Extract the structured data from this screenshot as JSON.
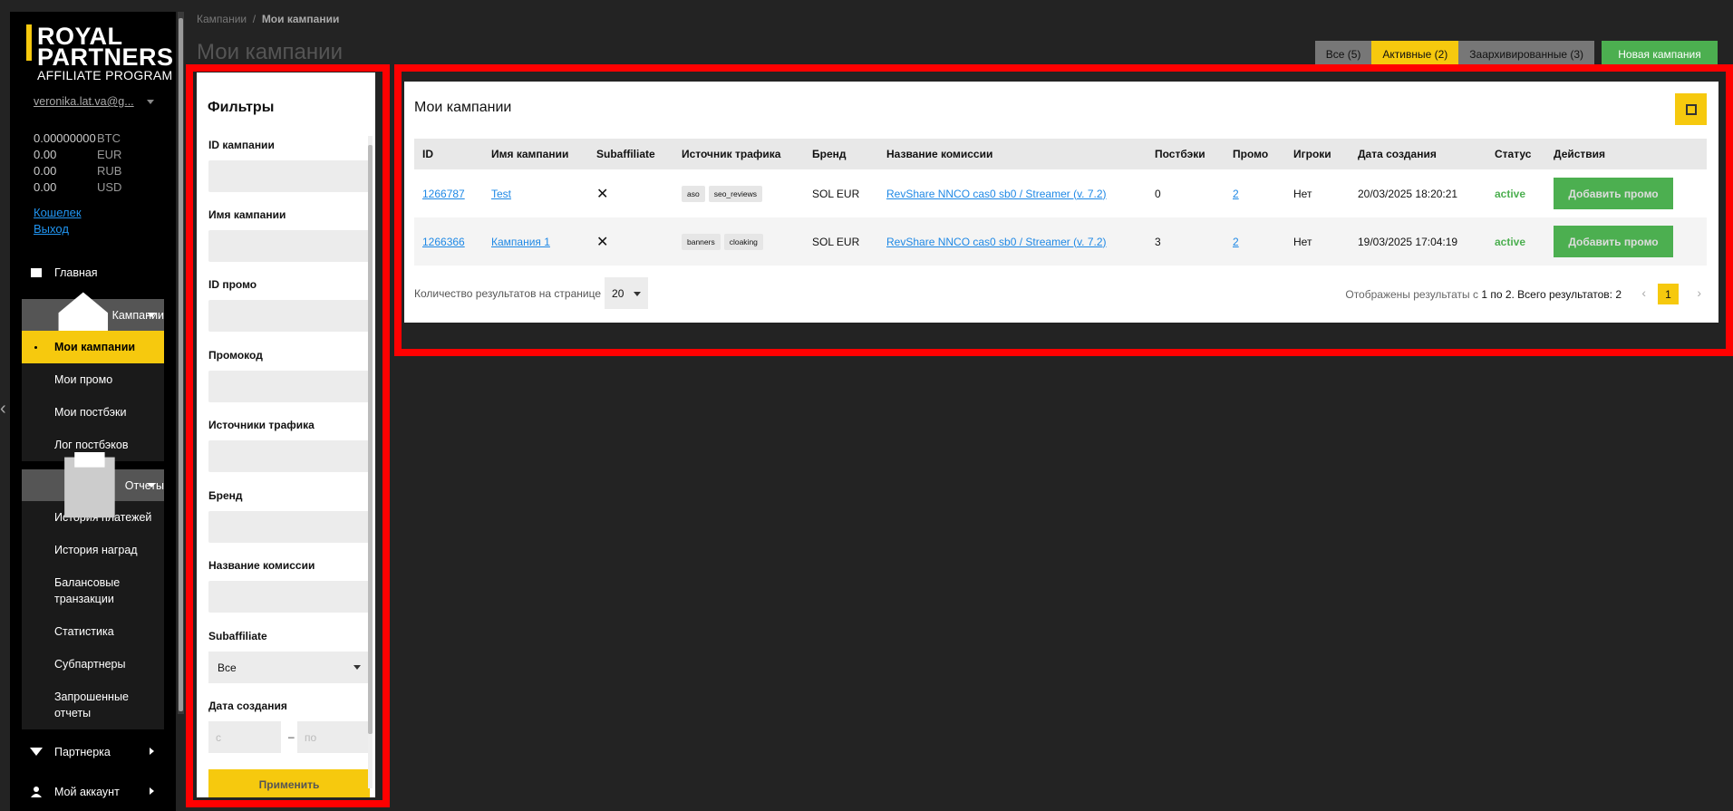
{
  "brand": {
    "line1": "ROYAL",
    "line2": "PARTNERS",
    "sub": "AFFILIATE PROGRAM"
  },
  "user": {
    "email": "veronika.lat.va@g..."
  },
  "balances": [
    {
      "amount": "0.00000000",
      "currency": "BTC"
    },
    {
      "amount": "0.00",
      "currency": "EUR"
    },
    {
      "amount": "0.00",
      "currency": "RUB"
    },
    {
      "amount": "0.00",
      "currency": "USD"
    }
  ],
  "links": {
    "wallet": "Кошелек",
    "logout": "Выход"
  },
  "sidebar": {
    "home": "Главная",
    "campaigns": "Кампании",
    "campaigns_items": [
      "Мои кампании",
      "Мои промо",
      "Мои постбэки",
      "Лог постбэков"
    ],
    "reports": "Отчеты",
    "reports_items": [
      "История платежей",
      "История наград",
      "Балансовые транзакции",
      "Статистика",
      "Субпартнеры",
      "Запрошенные отчеты"
    ],
    "partner": "Партнерка",
    "account": "Мой аккаунт"
  },
  "breadcrumb": {
    "root": "Кампании",
    "sep": "/",
    "current": "Мои кампании"
  },
  "page_title": "Мои кампании",
  "tabs": {
    "all": "Все (5)",
    "active": "Активные (2)",
    "archived": "Заархивированные (3)",
    "new": "Новая кампания"
  },
  "filters": {
    "title": "Фильтры",
    "campaign_id": "ID кампании",
    "campaign_name": "Имя кампании",
    "promo_id": "ID промо",
    "promocode": "Промокод",
    "sources": "Источники трафика",
    "brand": "Бренд",
    "commission": "Название комиссии",
    "subaffiliate": "Subaffiliate",
    "subaffiliate_value": "Все",
    "created": "Дата создания",
    "from_ph": "с",
    "dash": "–",
    "to_ph": "по",
    "apply": "Применить"
  },
  "card": {
    "title": "Мои кампании",
    "columns": [
      "ID",
      "Имя кампании",
      "Subaffiliate",
      "Источник трафика",
      "Бренд",
      "Название комиссии",
      "Постбэки",
      "Промо",
      "Игроки",
      "Дата создания",
      "Статус",
      "Действия"
    ],
    "rows": [
      {
        "id": "1266787",
        "name": "Test",
        "sub": "✕",
        "tags": [
          "aso",
          "seo_reviews"
        ],
        "brand": "SOL EUR",
        "commission": "RevShare NNCO cas0 sb0 / Streamer (v. 7.2)",
        "postbacks": "0",
        "promo": "2",
        "players": "Нет",
        "created": "20/03/2025 18:20:21",
        "status": "active",
        "action": "Добавить промо"
      },
      {
        "id": "1266366",
        "name": "Кампания 1",
        "sub": "✕",
        "tags": [
          "banners",
          "cloaking"
        ],
        "brand": "SOL EUR",
        "commission": "RevShare NNCO cas0 sb0 / Streamer (v. 7.2)",
        "postbacks": "3",
        "promo": "2",
        "players": "Нет",
        "created": "19/03/2025 17:04:19",
        "status": "active",
        "action": "Добавить промо"
      }
    ],
    "per_page_label": "Количество результатов на странице",
    "per_page": "20",
    "results_prefix": "Отображены результаты с",
    "results_range": "1 по 2. Всего результатов: 2",
    "page": "1",
    "prev": "‹",
    "next": "›"
  },
  "colors": {
    "accent": "#f6c90e",
    "success": "#4caf50",
    "highlight": "#ff0000"
  }
}
